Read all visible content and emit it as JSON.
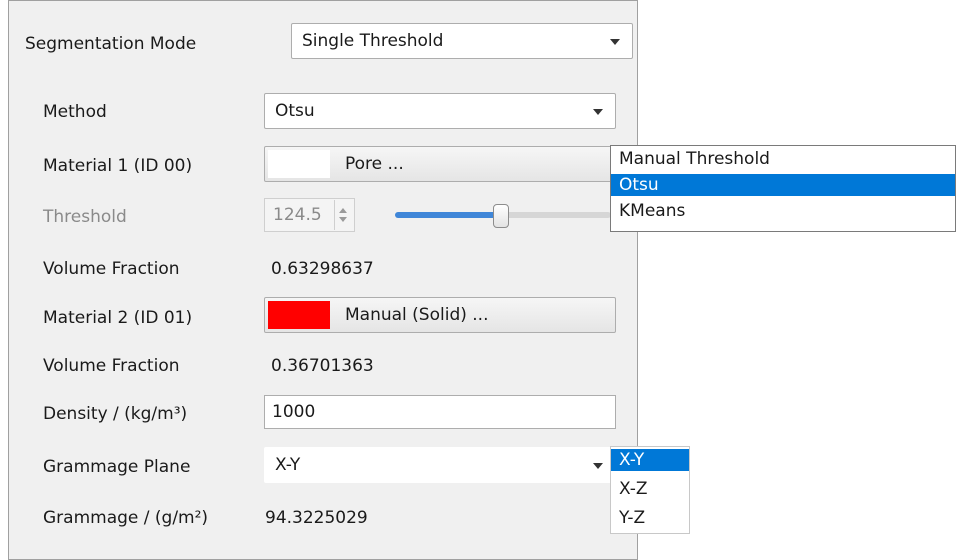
{
  "segmentation": {
    "label": "Segmentation Mode",
    "value": "Single Threshold"
  },
  "method": {
    "label": "Method",
    "value": "Otsu",
    "options": [
      "Manual Threshold",
      "Otsu",
      "KMeans"
    ],
    "selected_index": 1
  },
  "material1": {
    "label": "Material 1 (ID 00)",
    "button_label": "Pore ...",
    "color": "#ffffff"
  },
  "threshold": {
    "label": "Threshold",
    "value": "124.5",
    "slider_fraction": 0.5
  },
  "volume_fraction_1": {
    "label": "Volume Fraction",
    "value": "0.63298637"
  },
  "material2": {
    "label": "Material 2 (ID 01)",
    "button_label": "Manual (Solid) ...",
    "color": "#ff0000"
  },
  "volume_fraction_2": {
    "label": "Volume Fraction",
    "value": "0.36701363"
  },
  "density": {
    "label": "Density / (kg/m³)",
    "value": "1000"
  },
  "grammage_plane": {
    "label": "Grammage Plane",
    "value": "X-Y",
    "options": [
      "X-Y",
      "X-Z",
      "Y-Z"
    ],
    "selected_index": 0
  },
  "grammage": {
    "label": "Grammage / (g/m²)",
    "value": "94.3225029"
  },
  "colors": {
    "selection": "#0078d7",
    "slider_active": "#3f86d8",
    "slider_inactive": "#d6d6d6"
  }
}
